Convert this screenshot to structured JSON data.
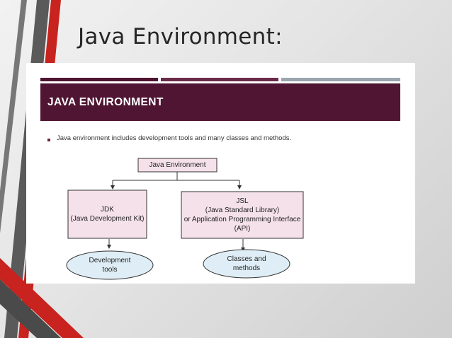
{
  "slide": {
    "title": "Java Environment:"
  },
  "panel": {
    "header": "JAVA ENVIRONMENT",
    "bullet": "Java environment includes development tools and many classes and methods."
  },
  "diagram": {
    "root": "Java Environment",
    "jdk": {
      "line1": "JDK",
      "line2": "(Java Development Kit)"
    },
    "jsl": {
      "line1": "JSL",
      "line2": "(Java Standard Library)",
      "line3": "or Application Programming Interface",
      "line4": "(API)"
    },
    "dev_tools": {
      "line1": "Development",
      "line2": "tools"
    },
    "classes": {
      "line1": "Classes and",
      "line2": "methods"
    }
  },
  "colors": {
    "header_band": "#4f1532",
    "box_fill": "#f5e1ea",
    "oval_fill": "#dfeef6",
    "accent_red": "#c8231f",
    "accent_dark": "#4a4a4a"
  }
}
